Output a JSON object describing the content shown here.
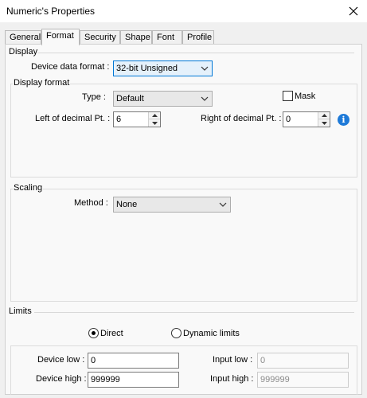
{
  "window": {
    "title": "Numeric's Properties"
  },
  "tabs": [
    {
      "label": "General"
    },
    {
      "label": "Format"
    },
    {
      "label": "Security"
    },
    {
      "label": "Shape"
    },
    {
      "label": "Font"
    },
    {
      "label": "Profile"
    }
  ],
  "active_tab": "Format",
  "display": {
    "section_label": "Display",
    "device_data_format_label": "Device data format :",
    "device_data_format_value": "32-bit Unsigned",
    "display_format": {
      "group_label": "Display format",
      "type_label": "Type :",
      "type_value": "Default",
      "mask_label": "Mask",
      "mask_checked": false,
      "left_decimal_label": "Left of decimal Pt. :",
      "left_decimal_value": "6",
      "right_decimal_label": "Right of decimal Pt. :",
      "right_decimal_value": "0",
      "info_icon": "i"
    },
    "scaling": {
      "group_label": "Scaling",
      "method_label": "Method :",
      "method_value": "None"
    }
  },
  "limits": {
    "section_label": "Limits",
    "direct_label": "Direct",
    "direct_selected": true,
    "dynamic_label": "Dynamic limits",
    "dynamic_selected": false,
    "device_low_label": "Device low :",
    "device_low_value": "0",
    "device_high_label": "Device high :",
    "device_high_value": "999999",
    "input_low_label": "Input low :",
    "input_low_value": "0",
    "input_high_label": "Input high :",
    "input_high_value": "999999"
  },
  "colors": {
    "accent": "#0078d7",
    "info": "#1e7ad8"
  }
}
